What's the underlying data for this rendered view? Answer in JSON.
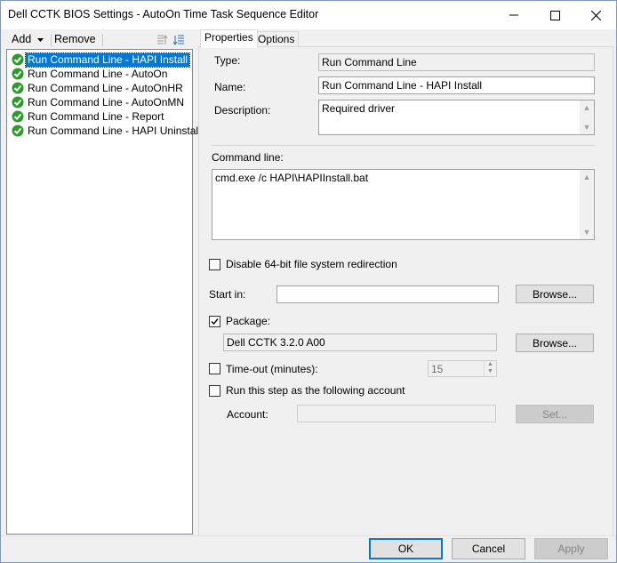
{
  "window": {
    "title": "Dell CCTK BIOS Settings - AutoOn Time Task Sequence Editor"
  },
  "toolbar": {
    "add_label": "Add",
    "remove_label": "Remove"
  },
  "tree": {
    "items": [
      {
        "label": "Run Command Line - HAPI Install",
        "selected": true
      },
      {
        "label": "Run Command Line - AutoOn",
        "selected": false
      },
      {
        "label": "Run Command Line - AutoOnHR",
        "selected": false
      },
      {
        "label": "Run Command Line - AutoOnMN",
        "selected": false
      },
      {
        "label": "Run Command Line - Report",
        "selected": false
      },
      {
        "label": "Run Command Line - HAPI Uninstall",
        "selected": false
      }
    ]
  },
  "tabs": [
    {
      "label": "Properties",
      "active": true
    },
    {
      "label": "Options",
      "active": false
    }
  ],
  "properties": {
    "type_label": "Type:",
    "type_value": "Run Command Line",
    "name_label": "Name:",
    "name_value": "Run Command Line - HAPI Install",
    "description_label": "Description:",
    "description_value": "Required driver",
    "command_line_label": "Command line:",
    "command_line_value": "cmd.exe /c HAPI\\HAPIInstall.bat",
    "disable_redirection_label": "Disable 64-bit file system redirection",
    "disable_redirection_checked": false,
    "start_in_label": "Start in:",
    "start_in_value": "",
    "browse_label": "Browse...",
    "package_label": "Package:",
    "package_checked": true,
    "package_value": "Dell CCTK 3.2.0 A00",
    "package_browse_label": "Browse...",
    "timeout_label": "Time-out (minutes):",
    "timeout_checked": false,
    "timeout_value": "15",
    "run_as_label": "Run this step as the following account",
    "run_as_checked": false,
    "account_label": "Account:",
    "account_value": "",
    "set_label": "Set..."
  },
  "footer": {
    "ok_label": "OK",
    "cancel_label": "Cancel",
    "apply_label": "Apply"
  },
  "colors": {
    "selection": "#0078d7",
    "success_icon": "#2e9a2e"
  }
}
